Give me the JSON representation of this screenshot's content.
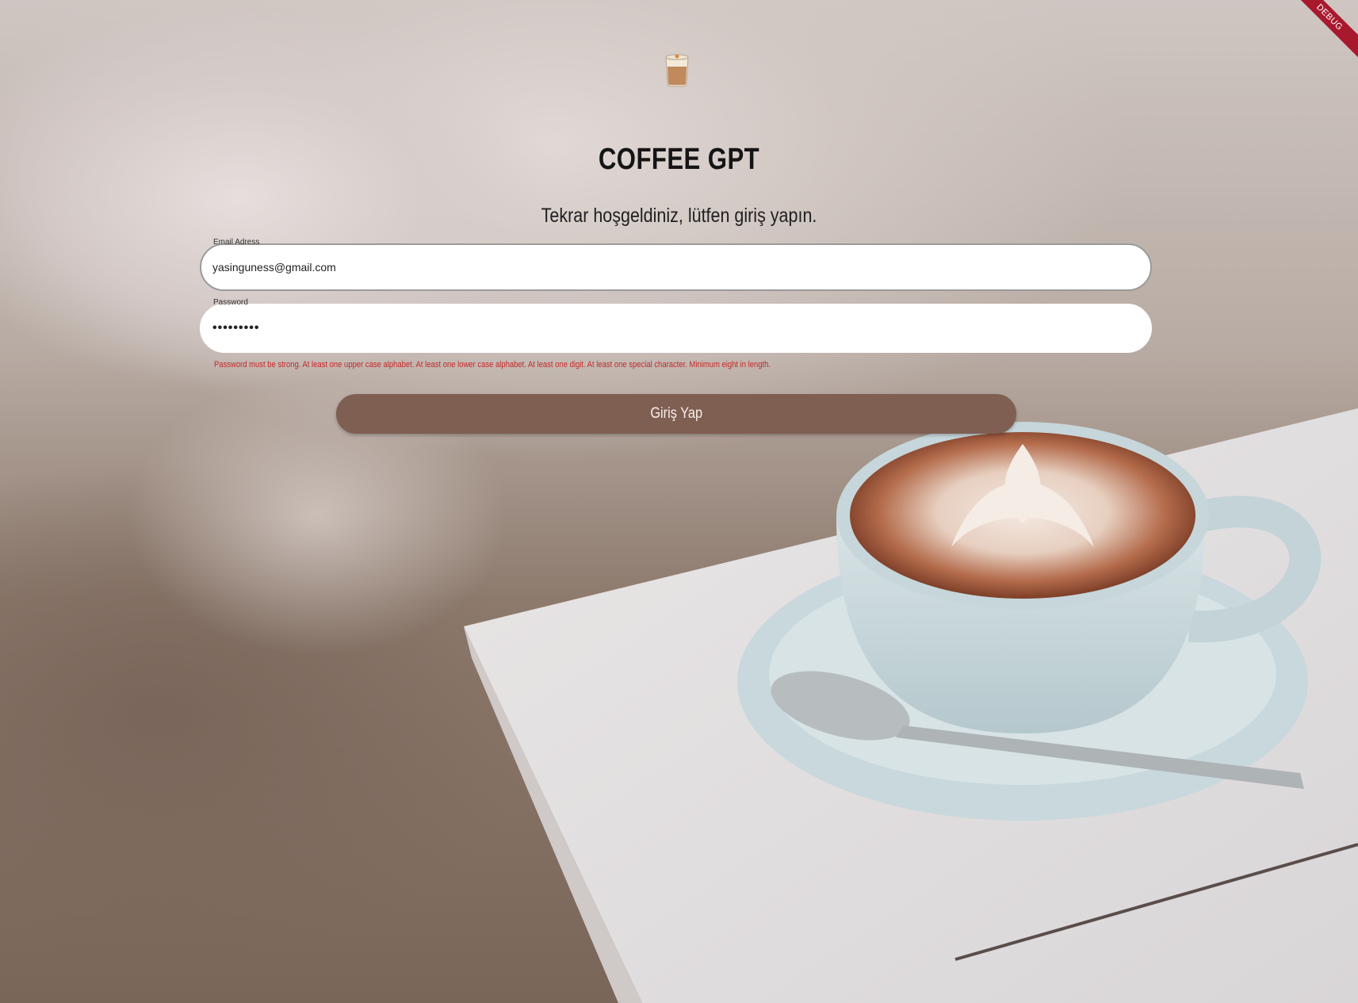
{
  "app": {
    "debug_banner": "DEBUG",
    "title": "COFFEE GPT",
    "subtitle": "Tekrar hoşgeldiniz, lütfen giriş yapın."
  },
  "form": {
    "email": {
      "label": "Email Adress",
      "value": "yasinguness@gmail.com"
    },
    "password": {
      "label": "Password",
      "value": "•••••••••",
      "error": "Password must be strong. At least one upper case alphabet. At least one lower case alphabet. At least one digit. At least one special character. Minimum eight in length."
    },
    "submit_label": "Giriş Yap"
  },
  "icons": {
    "logo": "coffee-cup-icon"
  },
  "colors": {
    "button": "#7f5f52",
    "error": "#c62828",
    "debug_ribbon": "#a8192e"
  }
}
